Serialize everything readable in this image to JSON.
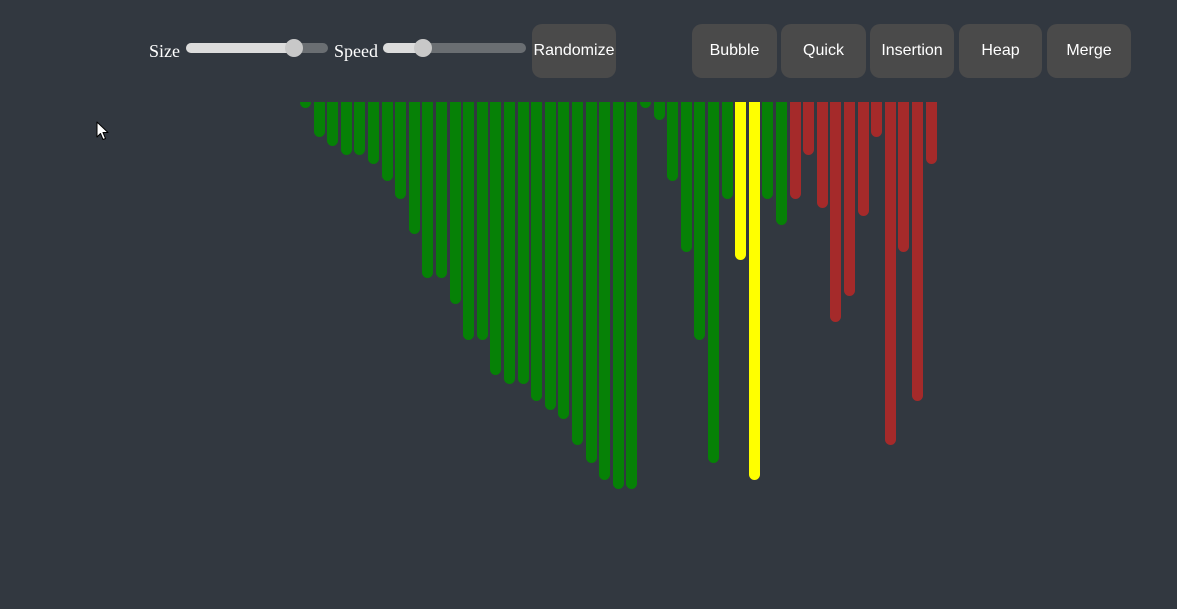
{
  "controls": {
    "size_label": "Size",
    "speed_label": "Speed",
    "size_value": 0.76,
    "speed_value": 0.28,
    "randomize_label": "Randomize"
  },
  "algorithms": [
    "Bubble",
    "Quick",
    "Insertion",
    "Heap",
    "Merge"
  ],
  "colors": {
    "background": "#323840",
    "sorted": "#068106",
    "comparing": "#ffff00",
    "unsorted": "#a52a2a"
  },
  "array": {
    "values": [
      1,
      8,
      10,
      12,
      12,
      14,
      18,
      22,
      30,
      40,
      40,
      46,
      54,
      54,
      62,
      64,
      64,
      68,
      70,
      72,
      78,
      82,
      86,
      88,
      88,
      1,
      4,
      18,
      34,
      54,
      82,
      22,
      36,
      86,
      22,
      28,
      22,
      12,
      24,
      50,
      44,
      26,
      8,
      78,
      34,
      68,
      14
    ],
    "states": [
      "sorted",
      "sorted",
      "sorted",
      "sorted",
      "sorted",
      "sorted",
      "sorted",
      "sorted",
      "sorted",
      "sorted",
      "sorted",
      "sorted",
      "sorted",
      "sorted",
      "sorted",
      "sorted",
      "sorted",
      "sorted",
      "sorted",
      "sorted",
      "sorted",
      "sorted",
      "sorted",
      "sorted",
      "sorted",
      "sorted",
      "sorted",
      "sorted",
      "sorted",
      "sorted",
      "sorted",
      "sorted",
      "comparing",
      "comparing",
      "sorted",
      "sorted",
      "unsorted",
      "unsorted",
      "unsorted",
      "unsorted",
      "unsorted",
      "unsorted",
      "unsorted",
      "unsorted",
      "unsorted",
      "unsorted",
      "unsorted"
    ]
  }
}
